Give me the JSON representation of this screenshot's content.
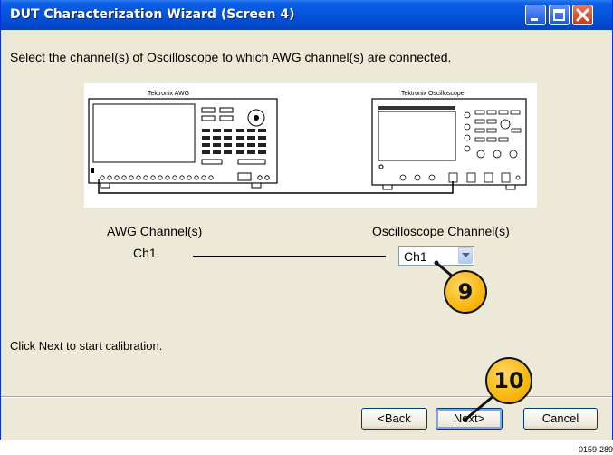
{
  "window": {
    "title": "DUT Characterization Wizard (Screen 4)"
  },
  "instruction": "Select the channel(s) of Oscilloscope to which AWG channel(s) are connected.",
  "diagram": {
    "awg_label": "Tektronix AWG",
    "scope_label": "Tektronix Oscilloscope"
  },
  "mapping": {
    "awg_header": "AWG Channel(s)",
    "scope_header": "Oscilloscope Channel(s)",
    "awg_channel": "Ch1",
    "scope_channel_selected": "Ch1"
  },
  "footer_text": "Click Next to start calibration.",
  "buttons": {
    "back": "<Back",
    "next": "Next>",
    "cancel": "Cancel"
  },
  "callouts": {
    "c9": "9",
    "c10": "10"
  },
  "figure_id": "0159-289",
  "colors": {
    "titlebar": "#0454dc",
    "dialog_bg": "#ece9d8",
    "callout": "#f6b300"
  }
}
